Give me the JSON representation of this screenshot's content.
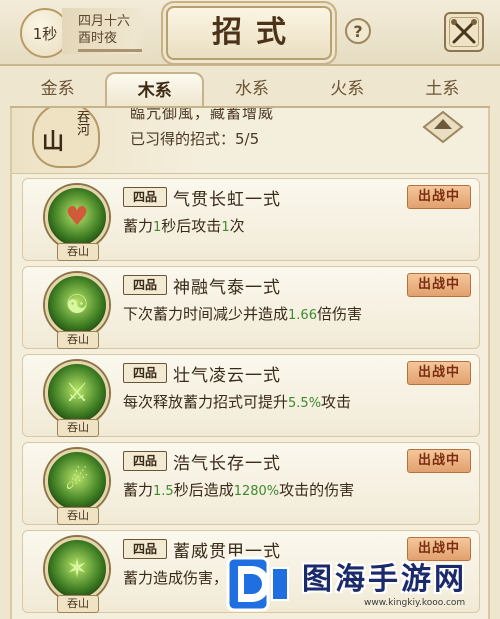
{
  "header": {
    "time_badge": "1秒",
    "date_line1": "四月十六",
    "date_line2": "酉时夜",
    "title": "招式",
    "help_label": "?"
  },
  "tabs": [
    {
      "label": "金系",
      "active": false
    },
    {
      "label": "木系",
      "active": true
    },
    {
      "label": "水系",
      "active": false
    },
    {
      "label": "火系",
      "active": false
    },
    {
      "label": "土系",
      "active": false
    }
  ],
  "school": {
    "seal_big": "山",
    "seal_small": "吞河",
    "motto": "臨亢御風，藏蓄增威",
    "learned_label": "已习得的招式：5/5"
  },
  "skills": [
    {
      "rank": "四品",
      "name": "气贯长虹一式",
      "school_tag": "吞山",
      "badge": "出战中",
      "desc_parts": [
        "蓄力",
        "1",
        "秒后攻击",
        "1",
        "次"
      ],
      "icon": "heart-icon",
      "glyph": "♥"
    },
    {
      "rank": "四品",
      "name": "神融气泰一式",
      "school_tag": "吞山",
      "badge": "出战中",
      "desc_parts": [
        "下次蓄力时间减少并造成",
        "1.66",
        "倍伤害"
      ],
      "icon": "meditation-icon",
      "glyph": "☯"
    },
    {
      "rank": "四品",
      "name": "壮气凌云一式",
      "school_tag": "吞山",
      "badge": "出战中",
      "desc_parts": [
        "每次释放蓄力招式可提升",
        "5.5%",
        "攻击"
      ],
      "icon": "warrior-icon",
      "glyph": "⚔"
    },
    {
      "rank": "四品",
      "name": "浩气长存一式",
      "school_tag": "吞山",
      "badge": "出战中",
      "desc_parts": [
        "蓄力",
        "1.5",
        "秒后造成",
        "1280%",
        "攻击的伤害"
      ],
      "icon": "swordsman-icon",
      "glyph": "☄"
    },
    {
      "rank": "四品",
      "name": "蓄威贯甲一式",
      "school_tag": "吞山",
      "badge": "出战中",
      "desc_parts": [
        "蓄力造成伤害，"
      ],
      "icon": "slash-icon",
      "glyph": "✶"
    }
  ],
  "watermark": {
    "text": "图海手游网",
    "url": "www.kingkiy.kooo.com"
  },
  "colors": {
    "highlight_green": "#3d8a2d",
    "badge_orange": "#e2a06e",
    "parchment": "#efe6cf"
  }
}
